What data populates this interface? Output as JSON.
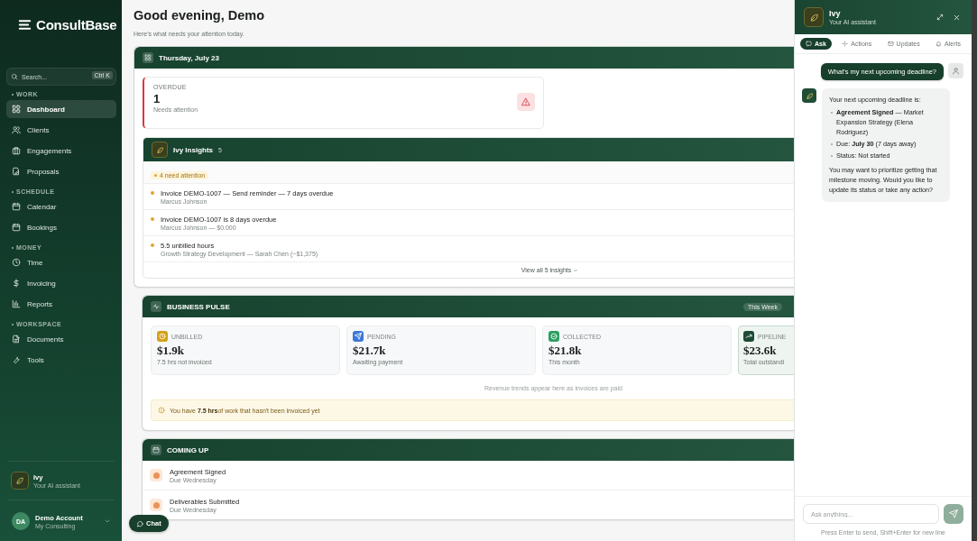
{
  "sidebar": {
    "logo": "ConsultBase",
    "search": {
      "placeholder": "Search...",
      "shortcut": "Ctrl K"
    },
    "sections": [
      {
        "heading": "WORK",
        "items": [
          {
            "label": "Dashboard",
            "selected": true
          },
          {
            "label": "Clients",
            "selected": false
          },
          {
            "label": "Engagements",
            "selected": false
          },
          {
            "label": "Proposals",
            "selected": false
          }
        ]
      },
      {
        "heading": "SCHEDULE",
        "items": [
          {
            "label": "Calendar",
            "selected": false
          },
          {
            "label": "Bookings",
            "selected": false
          }
        ]
      },
      {
        "heading": "MONEY",
        "items": [
          {
            "label": "Time",
            "selected": false
          },
          {
            "label": "Invoicing",
            "selected": false
          },
          {
            "label": "Reports",
            "selected": false
          }
        ]
      },
      {
        "heading": "WORKSPACE",
        "items": [
          {
            "label": "Documents",
            "selected": false
          },
          {
            "label": "Tools",
            "selected": false
          }
        ]
      }
    ],
    "assistant": {
      "name": "Ivy",
      "subtitle": "Your AI assistant"
    },
    "account": {
      "initials": "DA",
      "name": "Demo Account",
      "org": "My Consulting"
    }
  },
  "header": {
    "title": "Good evening, Demo",
    "subtitle": "Here's what needs your attention today."
  },
  "today": {
    "date": "Thursday, July 23",
    "overdue": {
      "label": "OVERDUE",
      "value": "1",
      "note": "Needs attention"
    }
  },
  "insights": {
    "title": "Ivy Insights",
    "count": "5",
    "badge": "4 need attention",
    "items": [
      {
        "title": "Invoice DEMO-1007 — Send reminder — 7 days overdue",
        "detail": "Marcus Johnson"
      },
      {
        "title": "Invoice DEMO-1007 is 8 days overdue",
        "detail": "Marcus Johnson — $0.000"
      },
      {
        "title": "5.5 unbilled hours",
        "detail": "Growth Strategy Development — Sarah Chen (~$1,375)"
      }
    ],
    "footer": "View all 5 insights"
  },
  "pulse": {
    "title": "BUSINESS PULSE",
    "period": "This Week",
    "stats": [
      {
        "label": "UNBILLED",
        "value": "$1.9k",
        "note": "7.5 hrs not invoiced",
        "color": "#d4a017",
        "selected": false
      },
      {
        "label": "PENDING",
        "value": "$21.7k",
        "note": "Awaiting payment",
        "color": "#3b78d8",
        "selected": false
      },
      {
        "label": "COLLECTED",
        "value": "$21.8k",
        "note": "This month",
        "color": "#2e9e62",
        "selected": false
      },
      {
        "label": "PIPELINE",
        "value": "$23.6k",
        "note": "Total outstandi",
        "color": "#1d4a35",
        "selected": true
      }
    ],
    "trend_note": "Revenue trends appear here as invoices are paid",
    "alert": "You have **7.5 hrs**of work that hasn't been invoiced yet"
  },
  "coming_up": {
    "title": "COMING UP",
    "items": [
      {
        "title": "Agreement Signed",
        "due": "Due Wednesday"
      },
      {
        "title": "Deliverables Submitted",
        "due": "Due Wednesday"
      }
    ]
  },
  "chat_button": "Chat",
  "chat": {
    "name": "Ivy",
    "subtitle": "Your AI assistant",
    "tabs": [
      {
        "label": "Ask",
        "selected": true
      },
      {
        "label": "Actions",
        "selected": false
      },
      {
        "label": "Updates",
        "selected": false
      },
      {
        "label": "Alerts",
        "selected": false
      }
    ],
    "messages": [
      {
        "kind": "user",
        "text": "What's my next upcoming deadline?"
      },
      {
        "kind": "assistant",
        "intro": "Your next upcoming deadline is:",
        "bullets": [
          "**Agreement Signed** — Market Expansion Strategy (Elena Rodriguez)",
          "Due: **July 30** (7 days away)",
          "Status: Not started"
        ],
        "outro": "You may want to prioritize getting that milestone moving. Would you like to update its status or take any action?"
      }
    ],
    "input": {
      "placeholder": "Ask anything..."
    },
    "hint": "Press Enter to send, Shift+Enter for new line"
  }
}
